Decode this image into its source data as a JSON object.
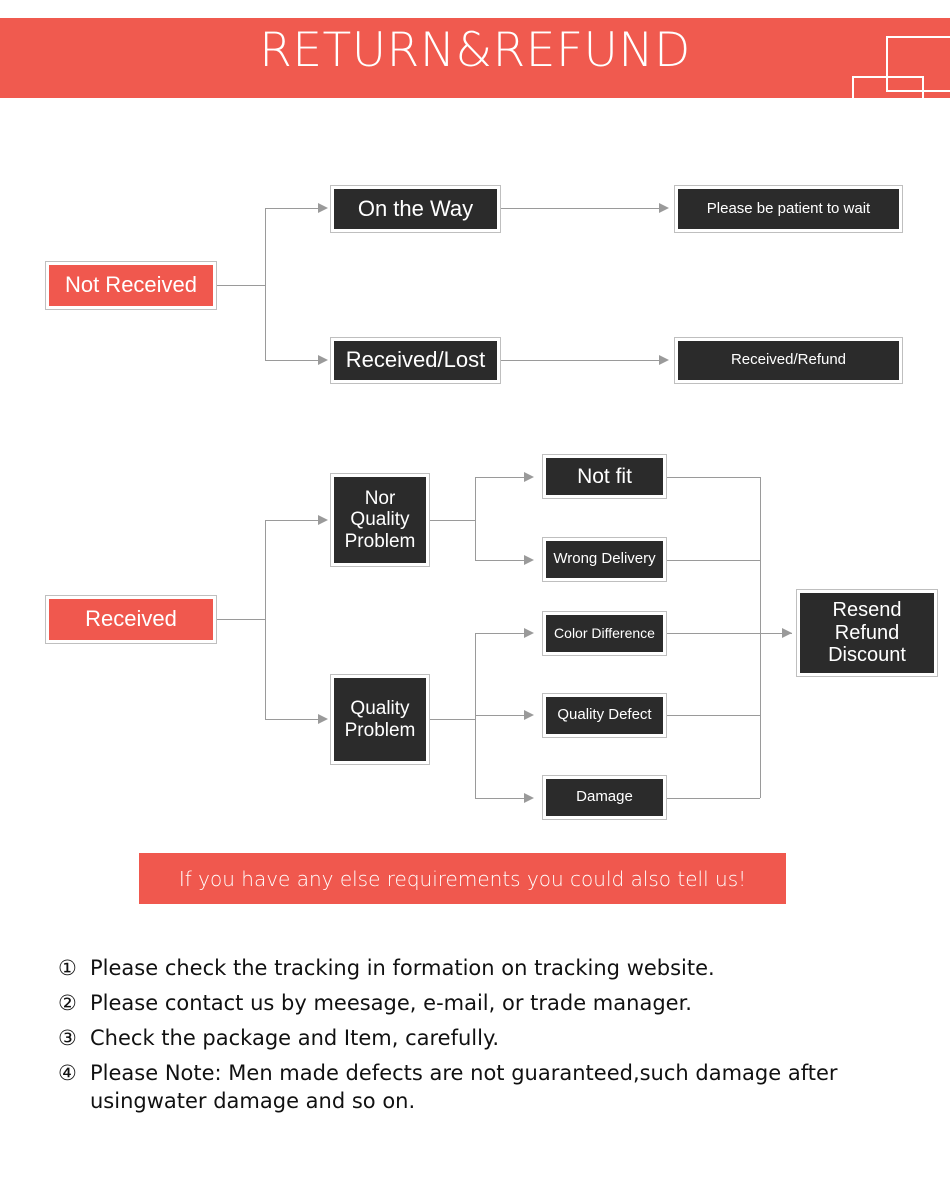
{
  "header": {
    "title": "RETURN&REFUND",
    "accent_color": "#f05a4f",
    "text_color": "#ffffff"
  },
  "colors": {
    "red": "#f0584e",
    "dark": "#2b2b2b",
    "line": "#9a9a9a",
    "border": "#bfbfbf"
  },
  "flowchart": {
    "branch_not_received": {
      "root": "Not Received",
      "stages": [
        {
          "label": "On the Way",
          "result": "Please be patient to wait"
        },
        {
          "label": "Received/Lost",
          "result": "Received/Refund"
        }
      ]
    },
    "branch_received": {
      "root": "Received",
      "categories": [
        {
          "label": "Nor\nQuality\nProblem",
          "reasons": [
            "Not fit",
            "Wrong Delivery"
          ]
        },
        {
          "label": "Quality\nProblem",
          "reasons": [
            "Color Difference",
            "Quality Defect",
            "Damage"
          ]
        }
      ],
      "outcome": "Resend\nRefund\nDiscount"
    }
  },
  "cta": {
    "text": "If you have any else requirements you could also tell us!"
  },
  "notes": [
    {
      "num": "①",
      "text": "Please check the tracking in formation on tracking website."
    },
    {
      "num": "②",
      "text": "Please contact us by meesage, e-mail, or trade manager."
    },
    {
      "num": "③",
      "text": "Check the package and Item, carefully."
    },
    {
      "num": "④",
      "text": "Please Note: Men made defects are not guaranteed,such damage after usingwater damage and so on."
    }
  ]
}
